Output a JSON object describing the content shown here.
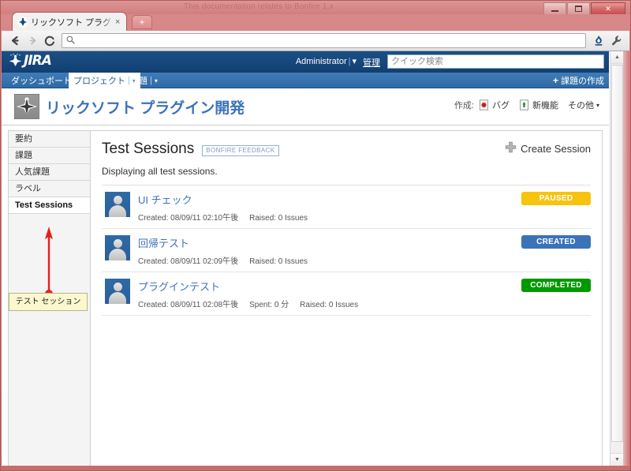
{
  "browser": {
    "window_title_note": "This documentation relates to Bonfire 1.x",
    "window_title_note_bold": "Bonfire 1.x",
    "tab_title": "リックソフト プラグイン開",
    "tab_close_label": "×",
    "new_tab_label": "+",
    "back_icon": "back-arrow-icon",
    "forward_icon": "forward-arrow-icon",
    "reload_icon": "C",
    "omnibox_value": "",
    "omnibox_placeholder": "",
    "search_icon": "search-icon",
    "bonfire_icon": "bonfire-flame-icon",
    "wrench_icon": "wrench-icon",
    "minimize_label": "",
    "maximize_label": "",
    "close_label": "✕"
  },
  "jira": {
    "logo_text": "JIRA",
    "user_name": "Administrator",
    "user_separator": "|",
    "user_caret": "▾",
    "admin_label": "管理",
    "quick_search_placeholder": "クイック検索",
    "nav": [
      {
        "label": "ダッシュボード",
        "bar": "|",
        "caret": "▾",
        "active": false
      },
      {
        "label": "プロジェクト",
        "bar": "|",
        "caret": "▾",
        "active": true
      },
      {
        "label": "課題",
        "bar": "|",
        "caret": "▾",
        "active": false
      }
    ],
    "create_issue_label": "課題の作成",
    "create_issue_plus": "+"
  },
  "project": {
    "title": "リックソフト プラグイン開発",
    "avatar_icon": "project-avatar-icon",
    "create_label": "作成:",
    "create_tools": [
      {
        "label": "バグ",
        "icon": "bug-icon",
        "color": "#cc3333"
      },
      {
        "label": "新機能",
        "icon": "new-feature-icon",
        "color": "#14892c"
      }
    ],
    "more_label": "その他",
    "more_caret": "▾"
  },
  "sidebar": {
    "items": [
      {
        "label": "要約",
        "active": false
      },
      {
        "label": "課題",
        "active": false
      },
      {
        "label": "人気課題",
        "active": false
      },
      {
        "label": "ラベル",
        "active": false
      },
      {
        "label": "Test Sessions",
        "active": true
      }
    ]
  },
  "main": {
    "page_title": "Test Sessions",
    "feedback_badge": "BONFIRE FEEDBACK",
    "create_session_label": "Create Session",
    "create_session_plus": "✛",
    "subtitle": "Displaying all test sessions.",
    "sessions": [
      {
        "name": "UI チェック",
        "created_label": "Created: 08/09/11 02:10午後",
        "spent_label": "",
        "raised_label": "Raised: 0 Issues",
        "status": "PAUSED",
        "status_color": "#f6c40f"
      },
      {
        "name": "回帰テスト",
        "created_label": "Created: 08/09/11 02:09午後",
        "spent_label": "",
        "raised_label": "Raised: 0 Issues",
        "status": "CREATED",
        "status_color": "#3b73b9"
      },
      {
        "name": "プラグインテスト",
        "created_label": "Created: 08/09/11 02:08午後",
        "spent_label": "Spent: 0 分",
        "raised_label": "Raised: 0 Issues",
        "status": "COMPLETED",
        "status_color": "#009900"
      }
    ]
  },
  "annotation": {
    "callout_text": "テスト セッション",
    "arrow_color": "#e8201a"
  },
  "scrollbar": {
    "up_arrow": "▲",
    "down_arrow": "▼"
  }
}
